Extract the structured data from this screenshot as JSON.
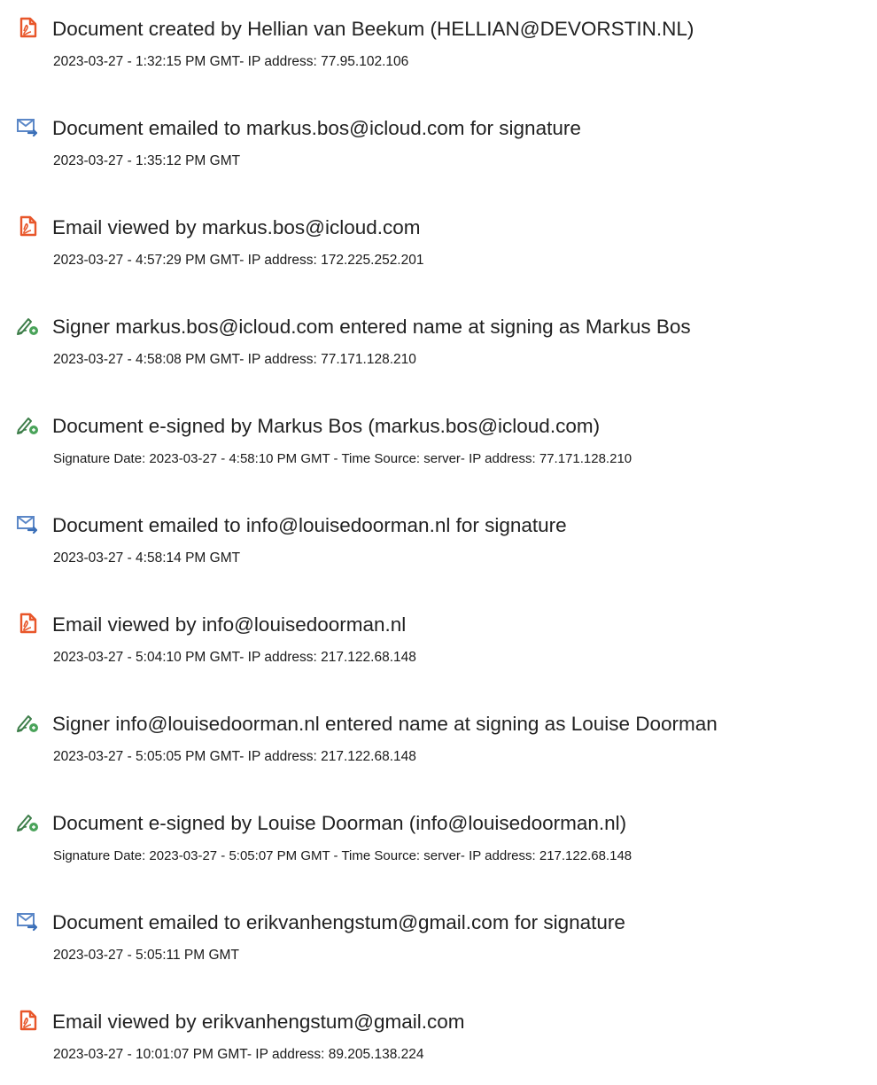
{
  "events": [
    {
      "type": "pdf-icon",
      "title": "Document created by Hellian van Beekum (HELLIAN@DEVORSTIN.NL)",
      "meta": "2023-03-27 - 1:32:15 PM GMT- IP address: 77.95.102.106"
    },
    {
      "type": "email-sent-icon",
      "title": "Document emailed to markus.bos@icloud.com for signature",
      "meta": "2023-03-27 - 1:35:12 PM GMT"
    },
    {
      "type": "pdf-icon",
      "title": "Email viewed by markus.bos@icloud.com",
      "meta": "2023-03-27 - 4:57:29 PM GMT- IP address: 172.225.252.201"
    },
    {
      "type": "esign-pen-icon",
      "title": "Signer markus.bos@icloud.com entered name at signing as Markus Bos",
      "meta": "2023-03-27 - 4:58:08 PM GMT- IP address: 77.171.128.210"
    },
    {
      "type": "esign-pen-icon",
      "title": "Document e-signed by Markus Bos (markus.bos@icloud.com)",
      "meta": "Signature Date: 2023-03-27 - 4:58:10 PM GMT - Time Source: server- IP address: 77.171.128.210"
    },
    {
      "type": "email-sent-icon",
      "title": "Document emailed to info@louisedoorman.nl for signature",
      "meta": "2023-03-27 - 4:58:14 PM GMT"
    },
    {
      "type": "pdf-icon",
      "title": "Email viewed by info@louisedoorman.nl",
      "meta": "2023-03-27 - 5:04:10 PM GMT- IP address: 217.122.68.148"
    },
    {
      "type": "esign-pen-icon",
      "title": "Signer info@louisedoorman.nl entered name at signing as Louise Doorman",
      "meta": "2023-03-27 - 5:05:05 PM GMT- IP address: 217.122.68.148"
    },
    {
      "type": "esign-pen-icon",
      "title": "Document e-signed by Louise Doorman (info@louisedoorman.nl)",
      "meta": "Signature Date: 2023-03-27 - 5:05:07 PM GMT - Time Source: server- IP address: 217.122.68.148"
    },
    {
      "type": "email-sent-icon",
      "title": "Document emailed to erikvanhengstum@gmail.com for signature",
      "meta": "2023-03-27 - 5:05:11 PM GMT"
    },
    {
      "type": "pdf-icon",
      "title": "Email viewed by erikvanhengstum@gmail.com",
      "meta": "2023-03-27 - 10:01:07 PM GMT- IP address: 89.205.138.224"
    }
  ],
  "colors": {
    "pdf_icon": "#e8562a",
    "email_icon": "#5b87c7",
    "email_arrow": "#3a6fb8",
    "pen_icon": "#3e7e4a",
    "pen_badge": "#4aa35a",
    "text": "#222222"
  }
}
